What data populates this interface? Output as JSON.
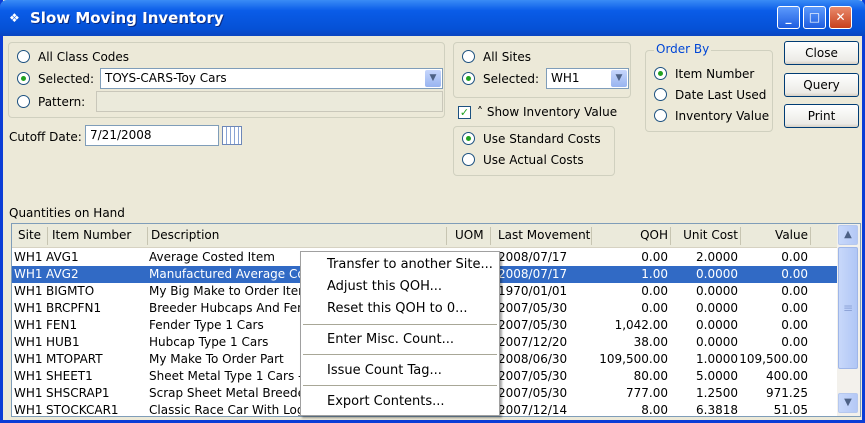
{
  "window": {
    "title": "Slow Moving Inventory",
    "minimize": "_",
    "maximize": "□",
    "close": "✕"
  },
  "class_codes": {
    "all_label": "All Class Codes",
    "selected_label": "Selected:",
    "selected_value": "TOYS-CARS-Toy Cars",
    "pattern_label": "Pattern:",
    "pattern_value": ""
  },
  "cutoff": {
    "label": "Cutoff Date:",
    "value": "7/21/2008"
  },
  "sites": {
    "all_label": "All Sites",
    "selected_label": "Selected:",
    "selected_value": "WH1"
  },
  "show_inventory_value": {
    "label": "Show Inventory Value",
    "checked": true
  },
  "costs": {
    "standard": "Use Standard Costs",
    "actual": "Use Actual Costs"
  },
  "order_by": {
    "title": "Order By",
    "options": [
      "Item Number",
      "Date Last Used",
      "Inventory Value"
    ],
    "selected": "Item Number"
  },
  "buttons": {
    "close": "Close",
    "query": "Query",
    "print": "Print"
  },
  "table": {
    "label": "Quantities on Hand",
    "columns": [
      "Site",
      "Item Number",
      "Description",
      "UOM",
      "Last Movement",
      "QOH",
      "Unit Cost",
      "Value"
    ],
    "rows": [
      [
        "WH1",
        "AVG1",
        "Average Costed Item",
        "",
        "2008/07/17",
        "0.00",
        "2.0000",
        "0.00"
      ],
      [
        "WH1",
        "AVG2",
        "Manufactured Average Cost",
        "",
        "2008/07/17",
        "1.00",
        "0.0000",
        "0.00"
      ],
      [
        "WH1",
        "BIGMTO",
        "My Big Make to Order Item",
        "",
        "1970/01/01",
        "0.00",
        "0.0000",
        "0.00"
      ],
      [
        "WH1",
        "BRCPFN1",
        "Breeder Hubcaps And Fenders",
        "",
        "2007/05/30",
        "0.00",
        "0.0000",
        "0.00"
      ],
      [
        "WH1",
        "FEN1",
        "Fender Type 1 Cars",
        "",
        "2007/05/30",
        "1,042.00",
        "0.0000",
        "0.00"
      ],
      [
        "WH1",
        "HUB1",
        "Hubcap Type 1 Cars",
        "",
        "2007/12/20",
        "38.00",
        "0.0000",
        "0.00"
      ],
      [
        "WH1",
        "MTOPART",
        "My Make To Order Part",
        "",
        "2008/06/30",
        "109,500.00",
        "1.0000",
        "109,500.00"
      ],
      [
        "WH1",
        "SHEET1",
        "Sheet Metal Type 1 Cars - ",
        "",
        "2007/05/30",
        "80.00",
        "5.0000",
        "400.00"
      ],
      [
        "WH1",
        "SHSCRAP1",
        "Scrap Sheet Metal Breeder",
        "",
        "2007/05/30",
        "777.00",
        "1.2500",
        "971.25"
      ],
      [
        "WH1",
        "STOCKCAR1",
        "Classic Race Car With Logo",
        "",
        "2007/12/14",
        "8.00",
        "6.3818",
        "51.05"
      ]
    ],
    "selected_row": 1
  },
  "context_menu": {
    "items": [
      "Transfer to another Site...",
      "Adjust this QOH...",
      "Reset this QOH to 0...",
      "Enter Misc. Count...",
      "Issue Count Tag...",
      "Export Contents..."
    ]
  }
}
